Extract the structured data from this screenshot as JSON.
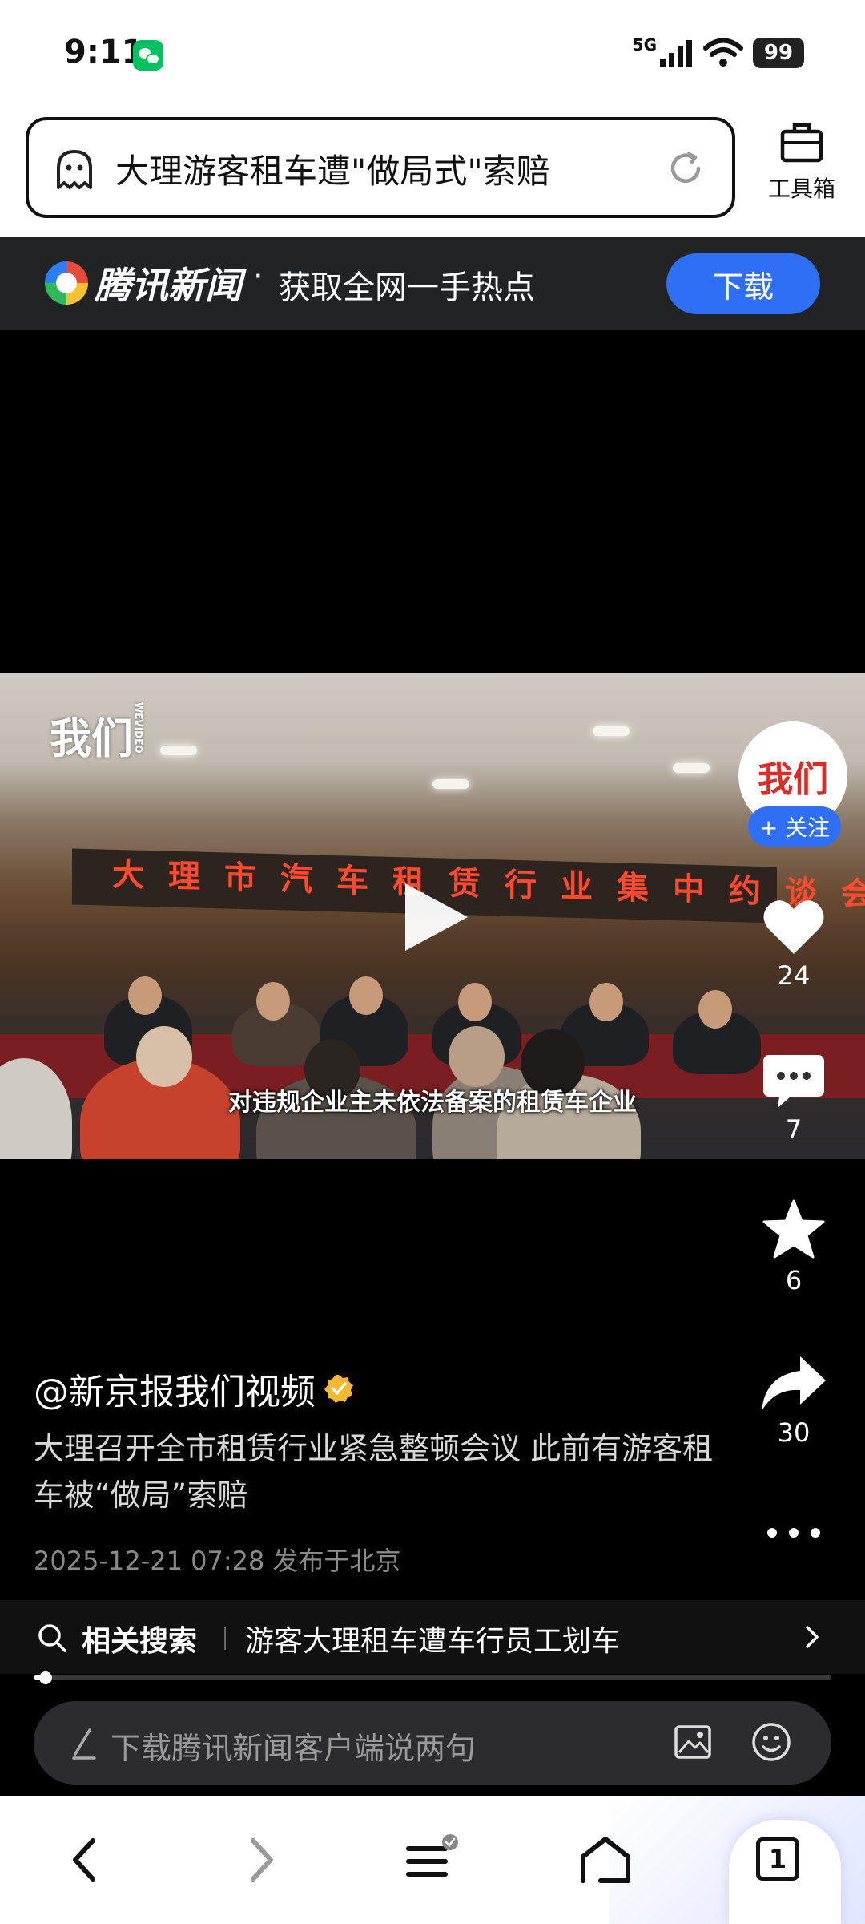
{
  "status_bar": {
    "time": "9:11",
    "network": "5G",
    "battery": "99"
  },
  "search": {
    "query": "大理游客租车遭\"做局式\"索赔",
    "toolbox_label": "工具箱"
  },
  "banner": {
    "brand": "腾讯新闻",
    "separator": "·",
    "slogan": "获取全网一手热点",
    "download_label": "下载"
  },
  "video": {
    "watermark": "我们",
    "watermark_small": "WEVIDEO",
    "wall_banner": "大理市汽车租赁行业集中约谈会议",
    "subtitle": "对违规企业主未依法备案的租赁车企业"
  },
  "rail": {
    "avatar_text": "我们",
    "follow_label": "+ 关注",
    "likes": "24",
    "comments": "7",
    "favorites": "6",
    "shares": "30"
  },
  "post": {
    "author": "@新京报我们视频",
    "caption": "大理召开全市租赁行业紧急整顿会议 此前有游客租车被“做局”索赔",
    "meta": "2025-12-21 07:28  发布于北京"
  },
  "related": {
    "title": "相关搜索",
    "query": "游客大理租车遭车行员工划车"
  },
  "playback": {
    "progress": 0.015
  },
  "comment": {
    "placeholder": "下载腾讯新闻客户端说两句"
  },
  "bottom_nav": {
    "tab_count": "1"
  },
  "colors": {
    "accent_blue": "#2f6ff6",
    "verified_gold": "#f5b82e",
    "banner_red": "#ff4a2e"
  }
}
